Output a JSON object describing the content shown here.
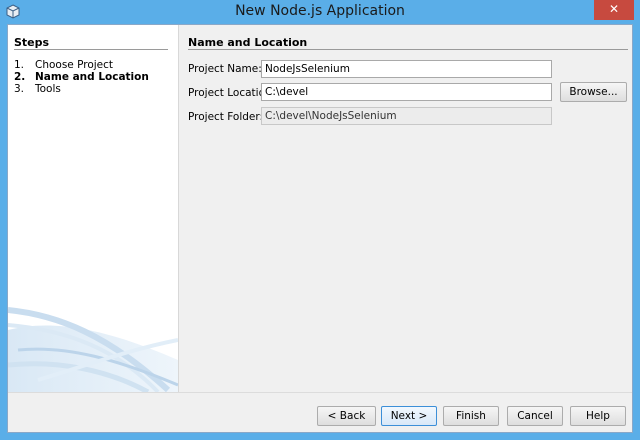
{
  "window": {
    "title": "New Node.js Application",
    "close_symbol": "✕"
  },
  "steps": {
    "title": "Steps",
    "items": [
      {
        "num": "1.",
        "label": "Choose Project",
        "current": false
      },
      {
        "num": "2.",
        "label": "Name and Location",
        "current": true
      },
      {
        "num": "3.",
        "label": "Tools",
        "current": false
      }
    ]
  },
  "section": {
    "title": "Name and Location"
  },
  "form": {
    "project_name_label": "Project Name:",
    "project_name_value": "NodeJsSelenium",
    "project_location_label": "Project Location:",
    "project_location_value": "C:\\devel",
    "browse_label": "Browse...",
    "project_folder_label": "Project Folder:",
    "project_folder_value": "C:\\devel\\NodeJsSelenium"
  },
  "buttons": {
    "back": "< Back",
    "next": "Next >",
    "finish": "Finish",
    "cancel": "Cancel",
    "help": "Help"
  },
  "colors": {
    "titlebar": "#5aaee8",
    "close": "#c74a3f",
    "default_button_border": "#3c8fd8"
  }
}
